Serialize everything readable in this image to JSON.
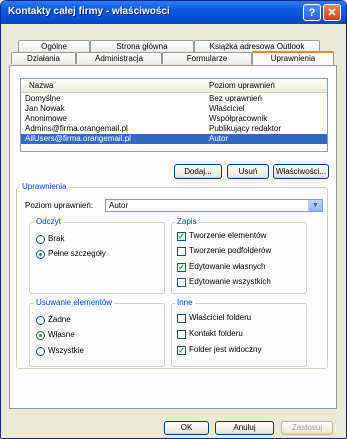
{
  "window": {
    "title": "Kontakty całej firmy - właściwości",
    "help_label": "?",
    "close_label": "✕"
  },
  "tabs_row1": [
    "Ogólne",
    "Strona główna",
    "Książka adresowa Outlook"
  ],
  "tabs_row2": [
    "Działania",
    "Administracja",
    "Formularze",
    "Uprawnienia"
  ],
  "active_tab": "Uprawnienia",
  "permissions_list": {
    "columns": [
      "Nazwa",
      "Poziom uprawnień"
    ],
    "rows": [
      {
        "name": "Domyślne",
        "level": "Bez uprawnień"
      },
      {
        "name": "Jan Nowak",
        "level": "Właściciel"
      },
      {
        "name": "Anonimowe",
        "level": "Współpracownik"
      },
      {
        "name": "Admins@firma.orangemail.pl",
        "level": "Publikujący redaktor"
      },
      {
        "name": "AllUsers@firma.orangemail.pl",
        "level": "Autor"
      }
    ],
    "selected_index": 4
  },
  "list_buttons": {
    "add": "Dodaj...",
    "remove": "Usuń",
    "properties": "Właściwości..."
  },
  "permissions": {
    "group_label": "Uprawnienia",
    "level_label": "Poziom uprawnień:",
    "level_value": "Autor",
    "read": {
      "label": "Odczyt",
      "options": [
        "Brak",
        "Pełne szczegóły"
      ],
      "selected": 1
    },
    "write": {
      "label": "Zapis",
      "options": [
        {
          "label": "Tworzenie elementów",
          "checked": true
        },
        {
          "label": "Tworzenie podfolderów",
          "checked": false
        },
        {
          "label": "Edytowanie własnych",
          "checked": true
        },
        {
          "label": "Edytowanie wszystkich",
          "checked": false
        }
      ]
    },
    "delete": {
      "label": "Usuwanie elementów",
      "options": [
        "Żadne",
        "Własne",
        "Wszystkie"
      ],
      "selected": 1
    },
    "other": {
      "label": "Inne",
      "options": [
        {
          "label": "Właściciel folderu",
          "checked": false
        },
        {
          "label": "Kontakt folderu",
          "checked": false
        },
        {
          "label": "Folder jest widoczny",
          "checked": true
        }
      ]
    }
  },
  "footer": {
    "ok": "OK",
    "cancel": "Anuluj",
    "apply": "Zastosuj"
  },
  "colors": {
    "selection": "#316ac5",
    "titlebar": "#0553d6",
    "group_label": "#0046d5"
  }
}
